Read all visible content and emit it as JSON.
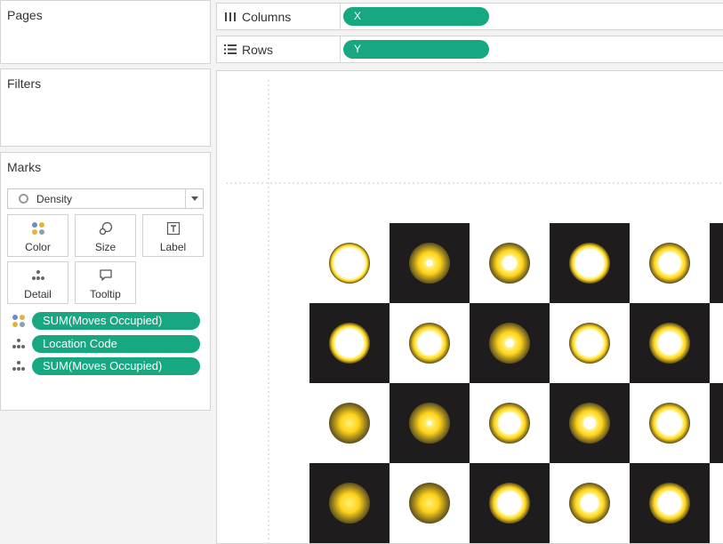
{
  "pages": {
    "title": "Pages"
  },
  "filters": {
    "title": "Filters"
  },
  "marks": {
    "title": "Marks",
    "mark_type": "Density",
    "buttons": [
      {
        "label": "Color",
        "icon": "color-dots-icon"
      },
      {
        "label": "Size",
        "icon": "size-icon"
      },
      {
        "label": "Label",
        "icon": "label-icon"
      },
      {
        "label": "Detail",
        "icon": "detail-icon"
      },
      {
        "label": "Tooltip",
        "icon": "tooltip-icon"
      }
    ],
    "fields": [
      {
        "label": "SUM(Moves Occupied)",
        "icon": "color-dots-icon"
      },
      {
        "label": "Location Code",
        "icon": "detail-icon"
      },
      {
        "label": "SUM(Moves Occupied)",
        "icon": "detail-icon"
      }
    ]
  },
  "shelves": {
    "columns": {
      "label": "Columns",
      "pill": "X",
      "icon": "columns-icon"
    },
    "rows": {
      "label": "Rows",
      "pill": "Y",
      "icon": "rows-icon"
    }
  },
  "colors": {
    "pill": "#17a882",
    "dark_cell": "#1e1c1c",
    "light_cell": "#ffffff",
    "density_core": "#fff27a",
    "density_mid": "#ffd21a",
    "density_edge": "#5a4e1e"
  },
  "chart_data": {
    "type": "heatmap",
    "mark": "density",
    "columns": 5,
    "rows": 4,
    "board_pattern": [
      [
        "light",
        "dark",
        "light",
        "dark",
        "light"
      ],
      [
        "dark",
        "light",
        "dark",
        "light",
        "dark"
      ],
      [
        "light",
        "dark",
        "light",
        "dark",
        "light"
      ],
      [
        "dark",
        "light",
        "dark",
        "light",
        "dark"
      ]
    ],
    "density_hole": [
      [
        0.78,
        0.15,
        0.35,
        0.72,
        0.55
      ],
      [
        0.72,
        0.6,
        0.2,
        0.68,
        0.58
      ],
      [
        0.0,
        0.1,
        0.55,
        0.3,
        0.62
      ],
      [
        0.05,
        0.0,
        0.6,
        0.45,
        0.58
      ]
    ]
  }
}
